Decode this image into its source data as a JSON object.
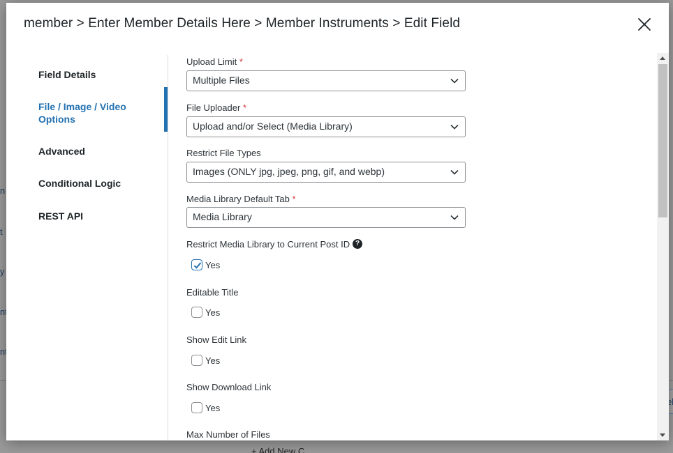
{
  "background": {
    "fragments": [
      "n",
      "t",
      "y",
      "nt",
      "nt"
    ],
    "bottom_text": "+ Add New C",
    "right_text": "el"
  },
  "modal": {
    "title": "member > Enter Member Details Here > Member Instruments > Edit Field"
  },
  "sidebar": {
    "items": [
      {
        "label": "Field Details",
        "active": false
      },
      {
        "label": "File / Image / Video Options",
        "active": true
      },
      {
        "label": "Advanced",
        "active": false
      },
      {
        "label": "Conditional Logic",
        "active": false
      },
      {
        "label": "REST API",
        "active": false
      }
    ]
  },
  "fields": {
    "upload_limit": {
      "label": "Upload Limit",
      "required": "*",
      "value": "Multiple Files"
    },
    "file_uploader": {
      "label": "File Uploader",
      "required": "*",
      "value": "Upload and/or Select (Media Library)"
    },
    "restrict_file_types": {
      "label": "Restrict File Types",
      "value": "Images (ONLY jpg, jpeg, png, gif, and webp)"
    },
    "media_library_default_tab": {
      "label": "Media Library Default Tab",
      "required": "*",
      "value": "Media Library"
    },
    "restrict_media_library": {
      "label": "Restrict Media Library to Current Post ID",
      "help": "?",
      "option": "Yes",
      "checked": true
    },
    "editable_title": {
      "label": "Editable Title",
      "option": "Yes",
      "checked": false
    },
    "show_edit_link": {
      "label": "Show Edit Link",
      "option": "Yes",
      "checked": false
    },
    "show_download_link": {
      "label": "Show Download Link",
      "option": "Yes",
      "checked": false
    },
    "max_number_of_files": {
      "label": "Max Number of Files"
    }
  },
  "colors": {
    "accent": "#2271b1",
    "required": "#d63638",
    "text": "#1d2327"
  }
}
